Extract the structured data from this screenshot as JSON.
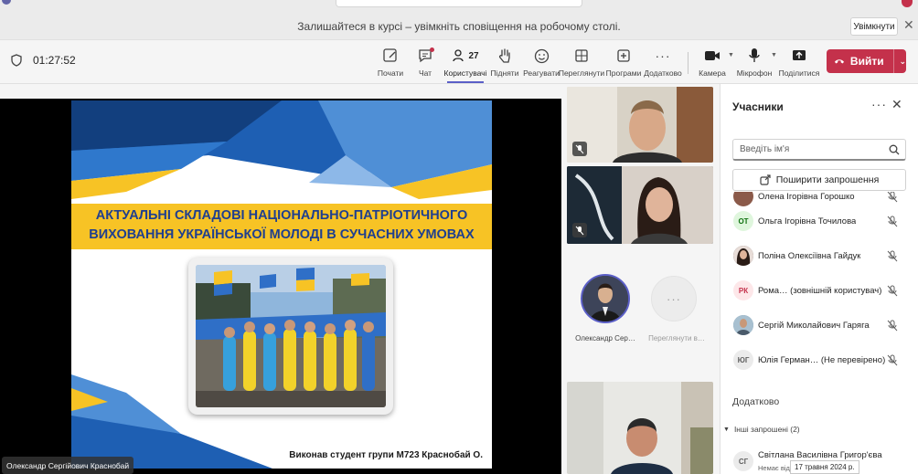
{
  "banner": {
    "message": "Залишайтеся в курсі – увімкніть сповіщення на робочому столі.",
    "enable_label": "Увімкнути"
  },
  "toolbar": {
    "timer": "01:27:52",
    "participants_count": "27",
    "items": [
      {
        "label": "Почати",
        "icon": "compose-icon"
      },
      {
        "label": "Чат",
        "icon": "chat-icon"
      },
      {
        "label": "Користувачі",
        "icon": "people-icon"
      },
      {
        "label": "Підняти",
        "icon": "raise-hand-icon"
      },
      {
        "label": "Реагувати",
        "icon": "react-icon"
      },
      {
        "label": "Переглянути",
        "icon": "view-icon"
      },
      {
        "label": "Програми",
        "icon": "apps-icon"
      },
      {
        "label": "Додатково",
        "icon": "more-icon"
      },
      {
        "label": "Камера",
        "icon": "camera-icon"
      },
      {
        "label": "Мікрофон",
        "icon": "mic-icon"
      },
      {
        "label": "Поділитися",
        "icon": "share-icon"
      }
    ],
    "leave_label": "Вийти"
  },
  "stage": {
    "slide_title": "АКТУАЛЬНІ СКЛАДОВІ НАЦІОНАЛЬНО-ПАТРІОТИЧНОГО ВИХОВАННЯ  УКРАЇНСЬКОЇ МОЛОДІ В СУЧАСНИХ УМОВАХ",
    "slide_author": "Виконав студент групи М723 Краснобай О.",
    "speaker_name": "Олександр Сергійович Краснобай"
  },
  "tiles": {
    "avatar_name": "Олександр Сер…",
    "more_label": "Переглянути в…"
  },
  "panel": {
    "title": "Учасники",
    "search_placeholder": "Введіть ім'я",
    "invite_label": "Поширити запрошення",
    "participants": [
      {
        "initials": "",
        "name": "Олена Ігорівна Горошко",
        "avatar_color": "#8b5a4a"
      },
      {
        "initials": "ОТ",
        "name": "Ольга Ігорівна Точилова",
        "avatar_color": "#dff6dd"
      },
      {
        "initials": "",
        "name": "Поліна Олексіївна Гайдук",
        "avatar_color": "#4a3b3b"
      },
      {
        "initials": "РК",
        "name": "Рома… (зовнішній користувач)",
        "avatar_color": "#fde7e9"
      },
      {
        "initials": "",
        "name": "Сергій Миколайович Гаряга",
        "avatar_color": "#6f8fa8"
      },
      {
        "initials": "ЮГ",
        "name": "Юлія Герман… (Не перевірено)",
        "avatar_color": "#ebebeb"
      }
    ],
    "section_label": "Додатково",
    "subsection_label": "Інші запрошені (2)",
    "invited": {
      "initials": "СГ",
      "name": "Світлана Василівна Григор'єва",
      "status": "Немає від…"
    },
    "date_tooltip": "17 травня 2024 р."
  },
  "colors": {
    "accent": "#5b5fc7",
    "leave": "#c4314b",
    "slide_band": "#f7c325",
    "slide_text": "#1f3f8f"
  }
}
